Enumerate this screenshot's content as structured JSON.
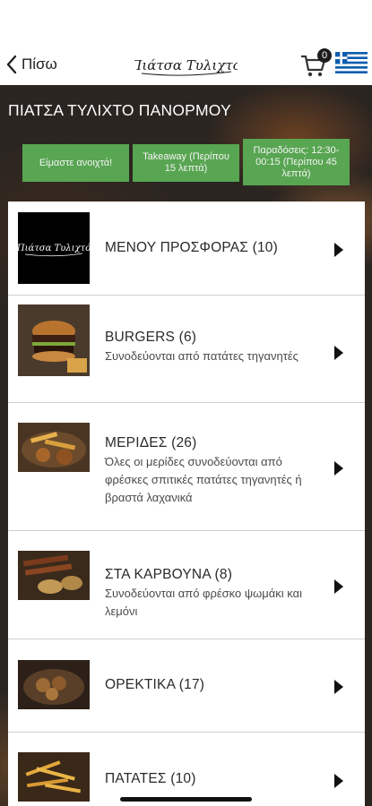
{
  "nav": {
    "back_label": "Πίσω",
    "logo_text": "Πιάτσα Τυλιχτό",
    "cart_count": "0",
    "language_flag": "greek-flag-icon"
  },
  "store": {
    "title": "ΠΙΑΤΣΑ ΤΥΛΙΧΤΟ ΠΑΝΟΡΜΟΥ",
    "status_open": "Είμαστε ανοιχτά!",
    "takeaway": "Takeaway (Περίπου 15 λεπτά)",
    "delivery": "Παραδόσεις: 12:30-00:15 (Περίπου 45 λεπτά)",
    "accent_color": "#58a552"
  },
  "categories": [
    {
      "name": "ΜΕΝΟΥ ΠΡΟΣΦΟΡΑΣ",
      "count": "(10)",
      "description": "",
      "thumb_logo": "Πιάτσα Τυλιχτό"
    },
    {
      "name": "BURGERS",
      "count": "(6)",
      "description": "Συνοδεύονται από πατάτες τηγανητές"
    },
    {
      "name": "ΜΕΡΙΔΕΣ",
      "count": "(26)",
      "description": "Όλες οι μερίδες συνοδεύονται από φρέσκες σπιτικές πατάτες τηγανητές ή βραστά λαχανικά"
    },
    {
      "name": "ΣΤΑ ΚΑΡΒΟΥΝΑ",
      "count": "(8)",
      "description": "Συνοδεύονται από φρέσκο ψωμάκι και λεμόνι"
    },
    {
      "name": "ΟΡΕΚΤΙΚΑ",
      "count": "(17)",
      "description": ""
    },
    {
      "name": "ΠΑΤΑΤΕΣ",
      "count": "(10)",
      "description": ""
    }
  ]
}
